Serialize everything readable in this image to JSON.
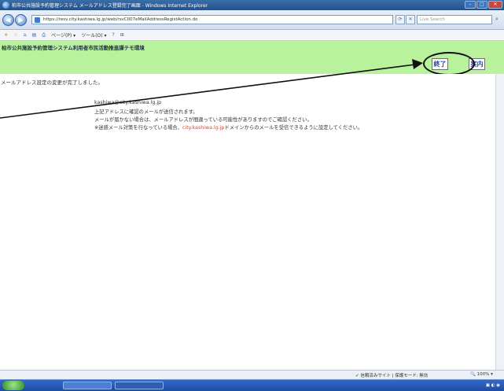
{
  "window": {
    "title": "柏市公共施設予約管理システム メールアドレス登録完了画面 - Windows Internet Explorer"
  },
  "address_bar": {
    "url": "https://resv.city.kashiwa.lg.jp/web/rsvC007eMailAddressRegistAction.do",
    "search_placeholder": "Live Search"
  },
  "command_bar": {
    "items": [
      "ページ(P)",
      "ツール(O)"
    ]
  },
  "app": {
    "title": "柏市公共施設予約管理システム利用者市民活動推進課テモ環境",
    "buttons": {
      "finish": "終了",
      "help": "案内"
    }
  },
  "content": {
    "completion_message": "メールアドレス設定の変更が完了しました。",
    "email": "kashiwa@city.kashiwa.lg.jp",
    "line1": "上記アドレスに確認のメールが送信されます。",
    "line2": "メールが届かない場合は、メールアドレスが間違っている可能性がありますのでご確認ください。",
    "line3_prefix": "※迷惑メール対策を行なっている場合、",
    "line3_domain": "city.kashiwa.lg.jp",
    "line3_suffix": "ドメインからのメールを受信できるように設定してください。"
  },
  "status_bar": {
    "zone": "信頼済みサイト | 保護モード: 無効",
    "zoom": "100%"
  },
  "colors": {
    "app_header": "#b8f29c",
    "link_highlight": "#d34a3a"
  }
}
